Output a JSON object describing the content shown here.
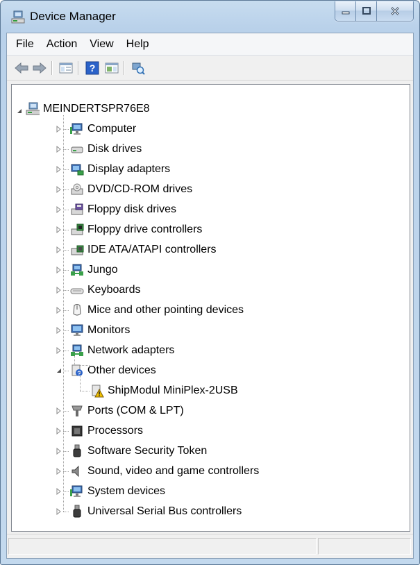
{
  "window": {
    "title": "Device Manager"
  },
  "menu": [
    "File",
    "Action",
    "View",
    "Help"
  ],
  "toolbar": [
    "back-icon",
    "forward-icon",
    "console-tree-icon",
    "help-icon",
    "properties-icon",
    "scan-hardware-icon"
  ],
  "tree": {
    "root": "MEINDERTSPR76E8",
    "categories": [
      "Computer",
      "Disk drives",
      "Display adapters",
      "DVD/CD-ROM drives",
      "Floppy disk drives",
      "Floppy drive controllers",
      "IDE ATA/ATAPI controllers",
      "Jungo",
      "Keyboards",
      "Mice and other pointing devices",
      "Monitors",
      "Network adapters",
      "Other devices",
      "Ports (COM & LPT)",
      "Processors",
      "Software Security Token",
      "Sound, video and game controllers",
      "System devices",
      "Universal Serial Bus controllers"
    ],
    "other_devices_child": "ShipModul MiniPlex-2USB"
  },
  "statusbar": {
    "left": "",
    "right": ""
  }
}
